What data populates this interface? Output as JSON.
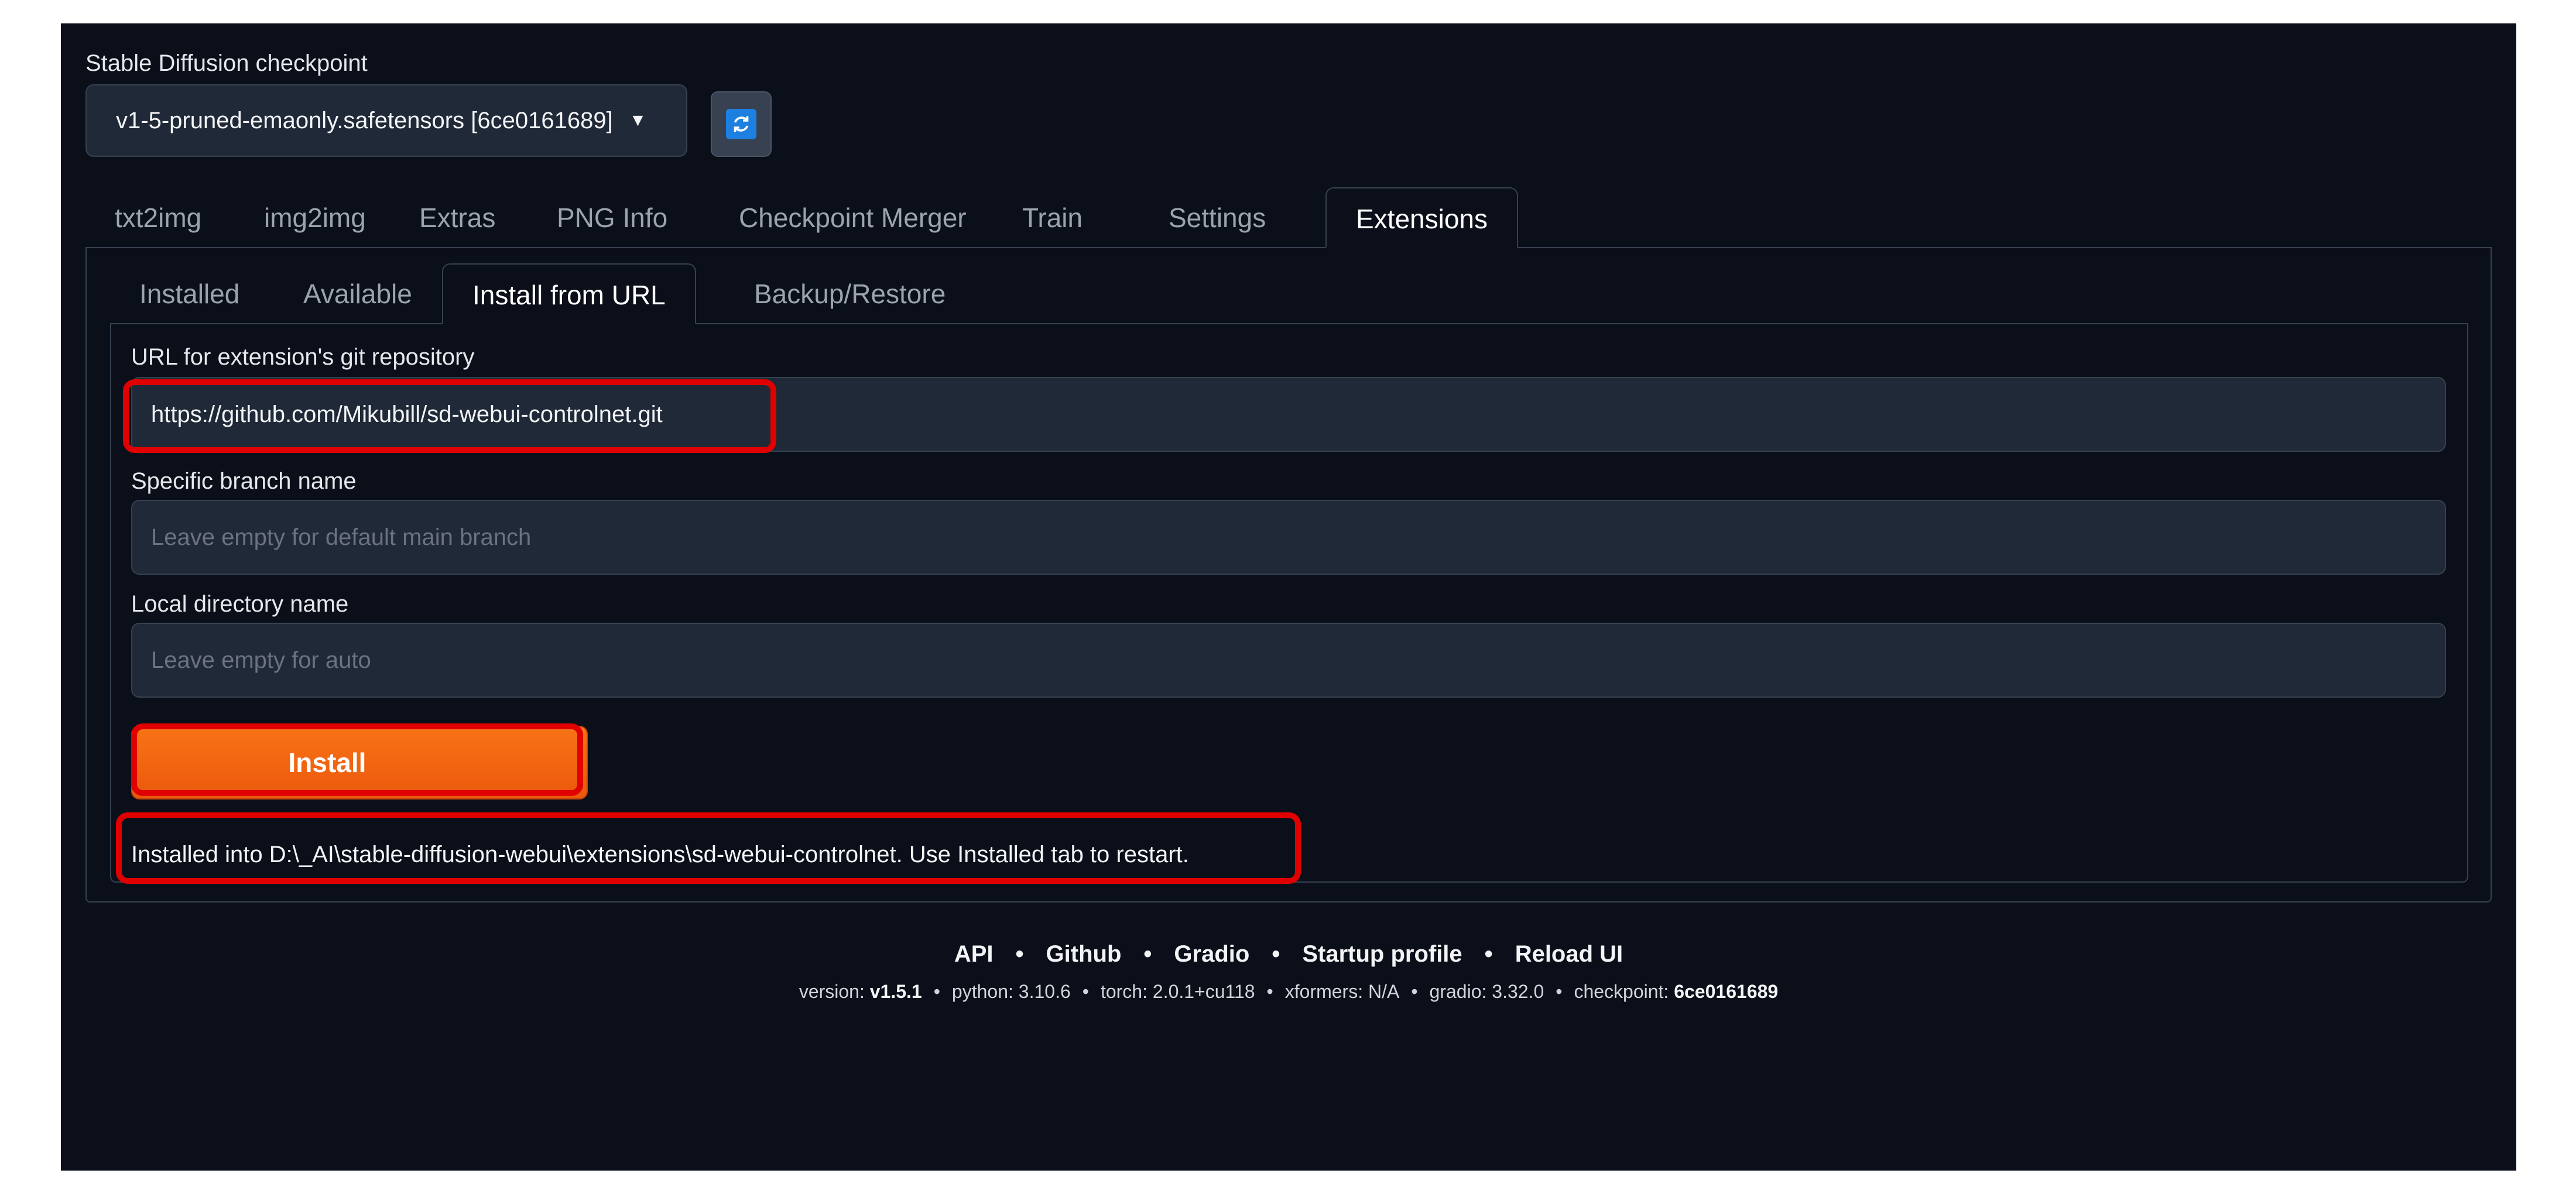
{
  "checkpoint": {
    "label": "Stable Diffusion checkpoint",
    "selected": "v1-5-pruned-emaonly.safetensors [6ce0161689]",
    "refresh_icon": "refresh-icon"
  },
  "tabs": [
    "txt2img",
    "img2img",
    "Extras",
    "PNG Info",
    "Checkpoint Merger",
    "Train",
    "Settings",
    "Extensions"
  ],
  "active_tab": "Extensions",
  "subtabs": [
    "Installed",
    "Available",
    "Install from URL",
    "Backup/Restore"
  ],
  "active_subtab": "Install from URL",
  "form": {
    "url_label": "URL for extension's git repository",
    "url_value": "https://github.com/Mikubill/sd-webui-controlnet.git",
    "branch_label": "Specific branch name",
    "branch_placeholder": "Leave empty for default main branch",
    "dir_label": "Local directory name",
    "dir_placeholder": "Leave empty for auto",
    "install_label": "Install",
    "result": "Installed into D:\\_AI\\stable-diffusion-webui\\extensions\\sd-webui-controlnet. Use Installed tab to restart."
  },
  "footer": {
    "links": [
      "API",
      "Github",
      "Gradio",
      "Startup profile",
      "Reload UI"
    ],
    "version_label": "version:",
    "version": "v1.5.1",
    "python": "python: 3.10.6",
    "torch": "torch: 2.0.1+cu118",
    "xformers": "xformers: N/A",
    "gradio": "gradio: 3.32.0",
    "checkpoint_label": "checkpoint:",
    "checkpoint": "6ce0161689",
    "separator": "•"
  },
  "colors": {
    "background": "#0b0f19",
    "accent": "#f97316",
    "highlight": "#e00000"
  }
}
